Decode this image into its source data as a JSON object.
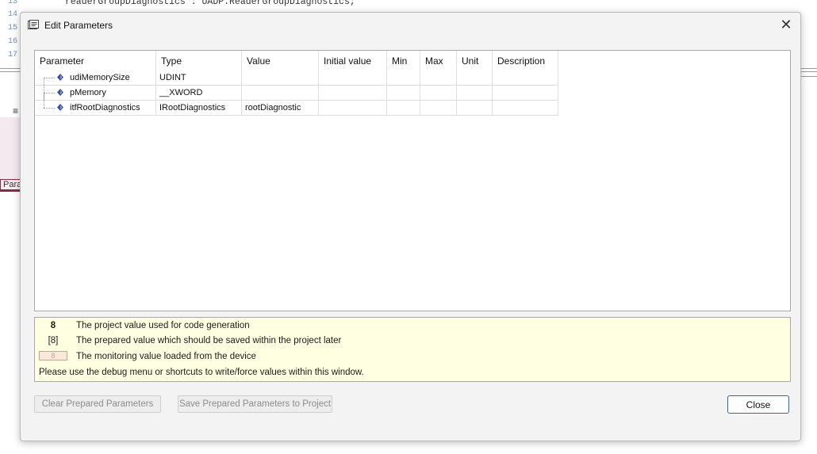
{
  "editor": {
    "line_numbers": [
      "13",
      "14",
      "15",
      "16",
      "17"
    ],
    "code_line": "readerGroupDiagnostics : UADP.ReaderGroupDiagnostics;",
    "menu_icon": "hamburger-icon",
    "tab_label": "Para"
  },
  "dialog": {
    "title": "Edit Parameters",
    "title_icon": "parameters-dialog-icon",
    "close_icon": "close-icon",
    "columns": [
      "Parameter",
      "Type",
      "Value",
      "Initial value",
      "Min",
      "Max",
      "Unit",
      "Description"
    ],
    "rows": [
      {
        "parameter": "udiMemorySize",
        "type": "UDINT",
        "value": "",
        "initial": "",
        "min": "",
        "max": "",
        "unit": "",
        "description": ""
      },
      {
        "parameter": "pMemory",
        "type": "__XWORD",
        "value": "",
        "initial": "",
        "min": "",
        "max": "",
        "unit": "",
        "description": ""
      },
      {
        "parameter": "itfRootDiagnostics",
        "type": "IRootDiagnostics",
        "value": "rootDiagnostic",
        "initial": "",
        "min": "",
        "max": "",
        "unit": "",
        "description": ""
      }
    ],
    "legend": {
      "project_symbol": "8",
      "project_text": "The project value used for code generation",
      "prepared_symbol": "[8]",
      "prepared_text": "The prepared value which should be saved within the project later",
      "monitoring_symbol": "8",
      "monitoring_text": "The monitoring value loaded from the device",
      "note": "Please use the debug menu or shortcuts to write/force values within this window."
    },
    "buttons": {
      "clear": "Clear Prepared Parameters",
      "save": "Save Prepared Parameters to Project",
      "close": "Close"
    }
  },
  "colors": {
    "legend_bg": "#ffffe1",
    "variable_icon": "#3a4fa0",
    "close_button_border": "#2a67b8",
    "tab_accent": "#8a2a4a"
  }
}
